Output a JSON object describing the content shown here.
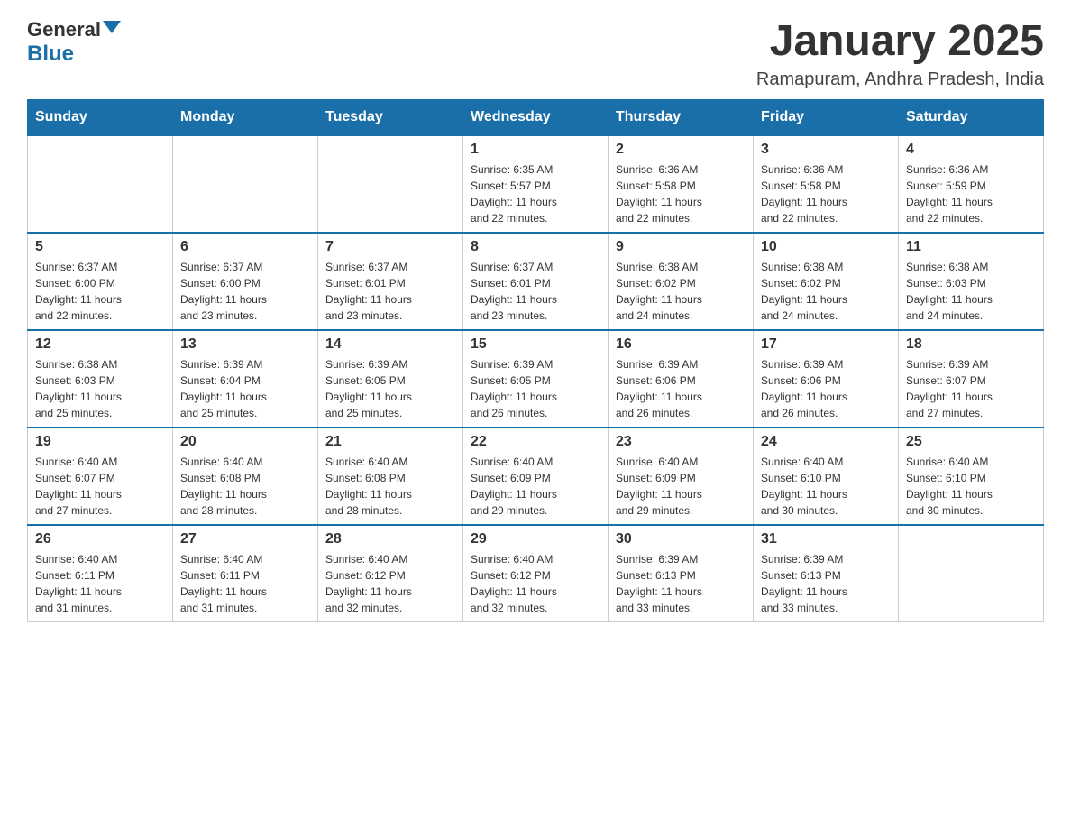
{
  "header": {
    "logo_general": "General",
    "logo_blue": "Blue",
    "month_title": "January 2025",
    "location": "Ramapuram, Andhra Pradesh, India"
  },
  "days_of_week": [
    "Sunday",
    "Monday",
    "Tuesday",
    "Wednesday",
    "Thursday",
    "Friday",
    "Saturday"
  ],
  "weeks": [
    [
      {
        "day": "",
        "info": ""
      },
      {
        "day": "",
        "info": ""
      },
      {
        "day": "",
        "info": ""
      },
      {
        "day": "1",
        "info": "Sunrise: 6:35 AM\nSunset: 5:57 PM\nDaylight: 11 hours\nand 22 minutes."
      },
      {
        "day": "2",
        "info": "Sunrise: 6:36 AM\nSunset: 5:58 PM\nDaylight: 11 hours\nand 22 minutes."
      },
      {
        "day": "3",
        "info": "Sunrise: 6:36 AM\nSunset: 5:58 PM\nDaylight: 11 hours\nand 22 minutes."
      },
      {
        "day": "4",
        "info": "Sunrise: 6:36 AM\nSunset: 5:59 PM\nDaylight: 11 hours\nand 22 minutes."
      }
    ],
    [
      {
        "day": "5",
        "info": "Sunrise: 6:37 AM\nSunset: 6:00 PM\nDaylight: 11 hours\nand 22 minutes."
      },
      {
        "day": "6",
        "info": "Sunrise: 6:37 AM\nSunset: 6:00 PM\nDaylight: 11 hours\nand 23 minutes."
      },
      {
        "day": "7",
        "info": "Sunrise: 6:37 AM\nSunset: 6:01 PM\nDaylight: 11 hours\nand 23 minutes."
      },
      {
        "day": "8",
        "info": "Sunrise: 6:37 AM\nSunset: 6:01 PM\nDaylight: 11 hours\nand 23 minutes."
      },
      {
        "day": "9",
        "info": "Sunrise: 6:38 AM\nSunset: 6:02 PM\nDaylight: 11 hours\nand 24 minutes."
      },
      {
        "day": "10",
        "info": "Sunrise: 6:38 AM\nSunset: 6:02 PM\nDaylight: 11 hours\nand 24 minutes."
      },
      {
        "day": "11",
        "info": "Sunrise: 6:38 AM\nSunset: 6:03 PM\nDaylight: 11 hours\nand 24 minutes."
      }
    ],
    [
      {
        "day": "12",
        "info": "Sunrise: 6:38 AM\nSunset: 6:03 PM\nDaylight: 11 hours\nand 25 minutes."
      },
      {
        "day": "13",
        "info": "Sunrise: 6:39 AM\nSunset: 6:04 PM\nDaylight: 11 hours\nand 25 minutes."
      },
      {
        "day": "14",
        "info": "Sunrise: 6:39 AM\nSunset: 6:05 PM\nDaylight: 11 hours\nand 25 minutes."
      },
      {
        "day": "15",
        "info": "Sunrise: 6:39 AM\nSunset: 6:05 PM\nDaylight: 11 hours\nand 26 minutes."
      },
      {
        "day": "16",
        "info": "Sunrise: 6:39 AM\nSunset: 6:06 PM\nDaylight: 11 hours\nand 26 minutes."
      },
      {
        "day": "17",
        "info": "Sunrise: 6:39 AM\nSunset: 6:06 PM\nDaylight: 11 hours\nand 26 minutes."
      },
      {
        "day": "18",
        "info": "Sunrise: 6:39 AM\nSunset: 6:07 PM\nDaylight: 11 hours\nand 27 minutes."
      }
    ],
    [
      {
        "day": "19",
        "info": "Sunrise: 6:40 AM\nSunset: 6:07 PM\nDaylight: 11 hours\nand 27 minutes."
      },
      {
        "day": "20",
        "info": "Sunrise: 6:40 AM\nSunset: 6:08 PM\nDaylight: 11 hours\nand 28 minutes."
      },
      {
        "day": "21",
        "info": "Sunrise: 6:40 AM\nSunset: 6:08 PM\nDaylight: 11 hours\nand 28 minutes."
      },
      {
        "day": "22",
        "info": "Sunrise: 6:40 AM\nSunset: 6:09 PM\nDaylight: 11 hours\nand 29 minutes."
      },
      {
        "day": "23",
        "info": "Sunrise: 6:40 AM\nSunset: 6:09 PM\nDaylight: 11 hours\nand 29 minutes."
      },
      {
        "day": "24",
        "info": "Sunrise: 6:40 AM\nSunset: 6:10 PM\nDaylight: 11 hours\nand 30 minutes."
      },
      {
        "day": "25",
        "info": "Sunrise: 6:40 AM\nSunset: 6:10 PM\nDaylight: 11 hours\nand 30 minutes."
      }
    ],
    [
      {
        "day": "26",
        "info": "Sunrise: 6:40 AM\nSunset: 6:11 PM\nDaylight: 11 hours\nand 31 minutes."
      },
      {
        "day": "27",
        "info": "Sunrise: 6:40 AM\nSunset: 6:11 PM\nDaylight: 11 hours\nand 31 minutes."
      },
      {
        "day": "28",
        "info": "Sunrise: 6:40 AM\nSunset: 6:12 PM\nDaylight: 11 hours\nand 32 minutes."
      },
      {
        "day": "29",
        "info": "Sunrise: 6:40 AM\nSunset: 6:12 PM\nDaylight: 11 hours\nand 32 minutes."
      },
      {
        "day": "30",
        "info": "Sunrise: 6:39 AM\nSunset: 6:13 PM\nDaylight: 11 hours\nand 33 minutes."
      },
      {
        "day": "31",
        "info": "Sunrise: 6:39 AM\nSunset: 6:13 PM\nDaylight: 11 hours\nand 33 minutes."
      },
      {
        "day": "",
        "info": ""
      }
    ]
  ]
}
